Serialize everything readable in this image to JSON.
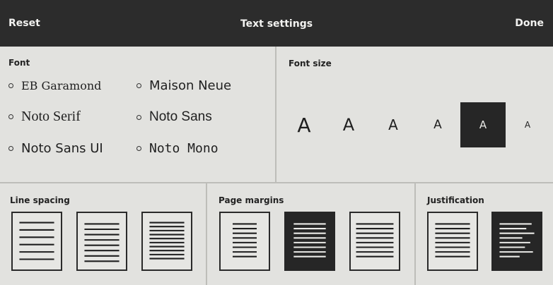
{
  "header": {
    "reset_label": "Reset",
    "title": "Text settings",
    "done_label": "Done"
  },
  "font_panel": {
    "title": "Font",
    "options": [
      {
        "label": "EB Garamond",
        "selected": false
      },
      {
        "label": "Maison Neue",
        "selected": false
      },
      {
        "label": "Noto Serif",
        "selected": false
      },
      {
        "label": "Noto Sans",
        "selected": false
      },
      {
        "label": "Noto Sans UI",
        "selected": false
      },
      {
        "label": "Noto Mono",
        "selected": false
      }
    ]
  },
  "font_size_panel": {
    "title": "Font size",
    "options": [
      {
        "label": "A",
        "selected": false
      },
      {
        "label": "A",
        "selected": false
      },
      {
        "label": "A",
        "selected": false
      },
      {
        "label": "A",
        "selected": false
      },
      {
        "label": "A",
        "selected": true
      },
      {
        "label": "A",
        "selected": false
      }
    ]
  },
  "line_spacing_panel": {
    "title": "Line spacing",
    "options": [
      {
        "icon": "wide-line-spacing-icon",
        "selected": false
      },
      {
        "icon": "medium-line-spacing-icon",
        "selected": false
      },
      {
        "icon": "narrow-line-spacing-icon",
        "selected": false
      }
    ]
  },
  "page_margins_panel": {
    "title": "Page margins",
    "options": [
      {
        "icon": "wide-margins-icon",
        "selected": false
      },
      {
        "icon": "medium-margins-icon",
        "selected": true
      },
      {
        "icon": "narrow-margins-icon",
        "selected": false
      }
    ]
  },
  "justification_panel": {
    "title": "Justification",
    "options": [
      {
        "icon": "justified-text-icon",
        "selected": false
      },
      {
        "icon": "left-aligned-text-icon",
        "selected": true
      }
    ]
  },
  "colors": {
    "header_bg": "#2c2c2c",
    "panel_bg": "#e2e2df",
    "selected_bg": "#262626"
  }
}
